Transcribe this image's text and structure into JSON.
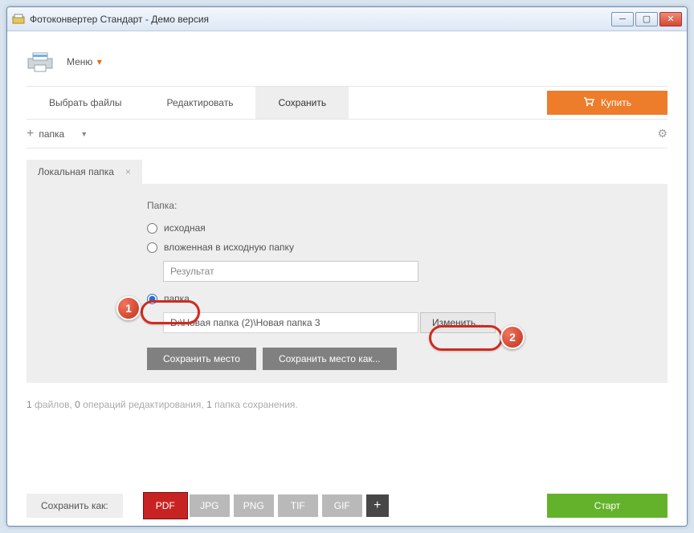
{
  "window": {
    "title": "Фотоконвертер Стандарт - Демо версия"
  },
  "menu": {
    "label": "Меню"
  },
  "tabs": {
    "select": "Выбрать файлы",
    "edit": "Редактировать",
    "save": "Сохранить"
  },
  "buy": {
    "label": "Купить"
  },
  "subbar": {
    "folder": "папка"
  },
  "smalltab": {
    "label": "Локальная папка",
    "close": "×"
  },
  "panel": {
    "folder_label": "Папка:",
    "radio_source": "исходная",
    "radio_nested": "вложенная в исходную папку",
    "nested_value": "Результат",
    "radio_folder": "папка",
    "path_value": "D:\\Новая папка (2)\\Новая папка 3",
    "change": "Изменить...",
    "save_place": "Сохранить место",
    "save_place_as": "Сохранить место как..."
  },
  "status": {
    "files_n": "1",
    "files_t": " файлов, ",
    "ops_n": "0",
    "ops_t": " операций редактирования, ",
    "save_n": "1",
    "save_t": " папка сохранения."
  },
  "bottom": {
    "save_as": "Сохранить как:",
    "pdf": "PDF",
    "jpg": "JPG",
    "png": "PNG",
    "tif": "TIF",
    "gif": "GIF",
    "plus": "+",
    "start": "Старт"
  },
  "badges": {
    "b1": "1",
    "b2": "2"
  }
}
